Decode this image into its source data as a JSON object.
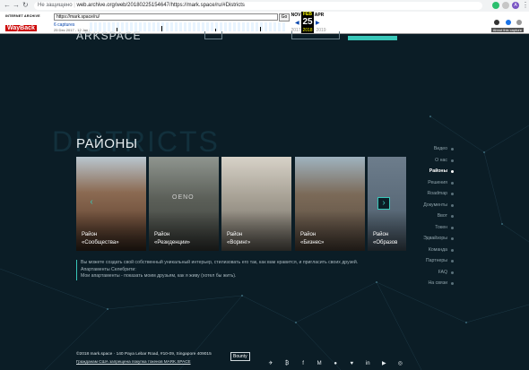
{
  "browser": {
    "back": "←",
    "forward": "→",
    "reload": "↻",
    "security": "Не защищено",
    "url": "web.archive.org/web/20180225154647/https://mark.space/ru/#Districts"
  },
  "wayback": {
    "logo_top": "INTERNET ARCHIVE",
    "logo_main": "WayBack",
    "input_url": "https://mark.space/ru/",
    "go": "Go",
    "captures": "6 captures",
    "range": "25 Dec 2017 - 12 Jan 2019",
    "months": [
      "NOV",
      "FEB",
      "APR"
    ],
    "day": "25",
    "years": [
      "2017",
      "2018",
      "2019"
    ],
    "about": "About this capture"
  },
  "page": {
    "title": "РАЙОНЫ",
    "watermark": "DISTRICTS",
    "logo_fragment": "ARKSPACE",
    "districts": [
      {
        "line1": "Район",
        "line2": "«Сообщества»"
      },
      {
        "line1": "Район",
        "line2": "«Резиденции»"
      },
      {
        "line1": "Район",
        "line2": "«Воринг»"
      },
      {
        "line1": "Район",
        "line2": "«Бизнес»"
      },
      {
        "line1": "Район",
        "line2": "«Образов"
      }
    ],
    "building_sign": "OENO",
    "description": [
      "Вы можете создать свой собственный уникальный интерьер, стилизовать его так, как вам нравится, и пригласить своих друзей.",
      "Апартаменты Селебрити:",
      "Мои апартаменты - показать моим друзьям, как я живу (хотел бы жить)."
    ]
  },
  "nav": {
    "items": [
      "Видео",
      "О нас",
      "Районы",
      "Решения",
      "Roadmap",
      "Документы",
      "Ввот",
      "Токен",
      "Эдвайзоры",
      "Команда",
      "Партнеры",
      "FAQ",
      "На связи"
    ],
    "active_index": 2
  },
  "footer": {
    "address": "©2018 mark.space · 140 Paya Lebar Road, #10-09, Singapore 409015",
    "warning": "Гражданам США запрещена покупка токенов MARK.SPACE",
    "bounty": "Bounty",
    "socials": [
      "telegram-icon",
      "bitcointalk-icon",
      "facebook-icon",
      "medium-icon",
      "reddit-icon",
      "twitter-icon",
      "linkedin-icon",
      "youtube-icon",
      "instagram-icon"
    ]
  },
  "colors": {
    "accent": "#38c7b9",
    "background": "#0b1d26"
  }
}
